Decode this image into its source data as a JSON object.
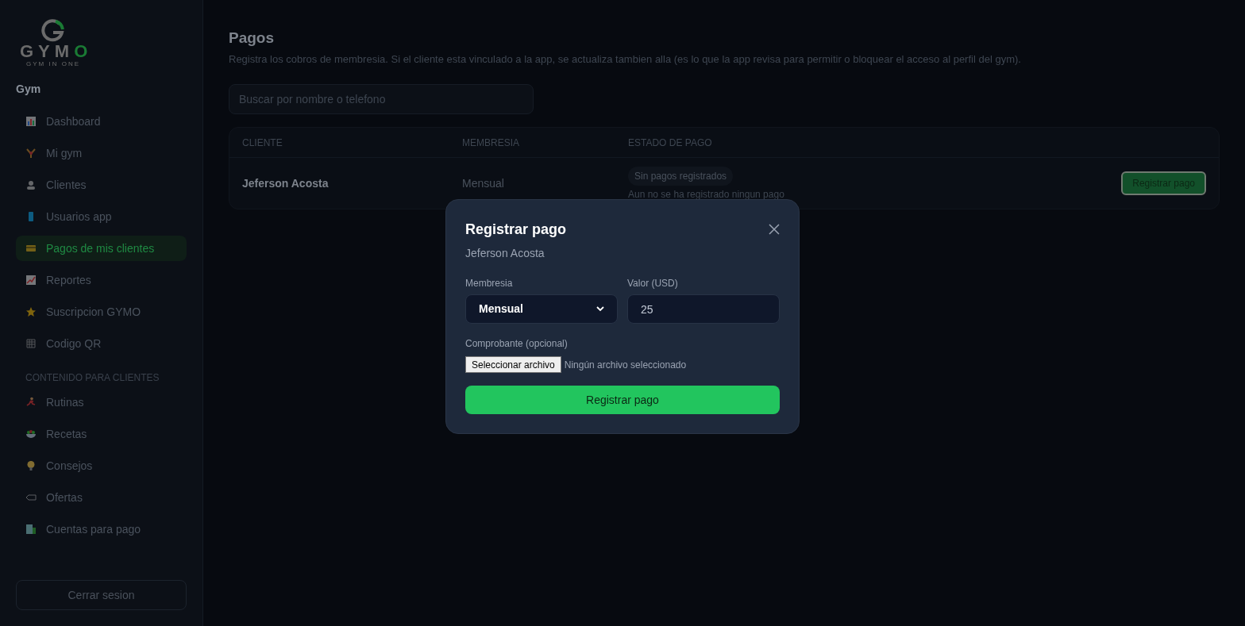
{
  "logo": {
    "wordmark": "GYM",
    "wordmark_accent": "O",
    "tagline": "GYM IN ONE"
  },
  "sidebar": {
    "section_title": "Gym",
    "items": [
      {
        "label": "Dashboard",
        "selected": false
      },
      {
        "label": "Mi gym",
        "selected": false
      },
      {
        "label": "Clientes",
        "selected": false
      },
      {
        "label": "Usuarios app",
        "selected": false
      },
      {
        "label": "Pagos de mis clientes",
        "selected": true
      },
      {
        "label": "Reportes",
        "selected": false
      },
      {
        "label": "Suscripcion GYMO",
        "selected": false
      },
      {
        "label": "Codigo QR",
        "selected": false
      }
    ],
    "content_section_title": "CONTENIDO PARA CLIENTES",
    "content_items": [
      {
        "label": "Rutinas",
        "selected": false
      },
      {
        "label": "Recetas",
        "selected": false
      },
      {
        "label": "Consejos",
        "selected": false
      },
      {
        "label": "Ofertas",
        "selected": false
      },
      {
        "label": "Cuentas para pago",
        "selected": false
      }
    ],
    "logout_button": "Cerrar sesion"
  },
  "page": {
    "title": "Pagos",
    "description": "Registra los cobros de membresia. Si el cliente esta vinculado a la app, se actualiza tambien alla (es lo que la app revisa para permitir o bloquear el acceso al perfil del gym).",
    "search": {
      "placeholder": "Buscar por nombre o telefono"
    }
  },
  "table": {
    "columns": [
      "CLIENTE",
      "MEMBRESIA",
      "ESTADO DE PAGO"
    ],
    "rows": [
      {
        "client": "Jeferson Acosta",
        "membership": "Mensual",
        "status_badge": "Sin pagos registrados",
        "status_note": "Aun no se ha registrado ningun pago",
        "action": "Registrar pago"
      }
    ]
  },
  "modal": {
    "title": "Registrar pago",
    "subtitle": "Jeferson Acosta",
    "membership_label": "Membresia",
    "membership_value": "Mensual",
    "amount_label": "Valor (USD)",
    "amount_value": "25",
    "receipt_label": "Comprobante (opcional)",
    "file_button": "Seleccionar archivo",
    "file_status": "Ningún archivo seleccionado",
    "submit": "Registrar pago"
  }
}
